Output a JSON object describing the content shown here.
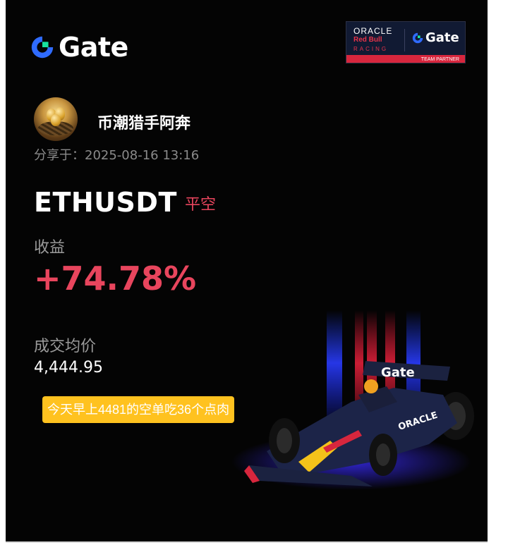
{
  "brand": {
    "name": "Gate",
    "color": "#2f6bff"
  },
  "partner": {
    "oracle": "ORACLE",
    "redbull": "Red Bull",
    "racing": "RACING",
    "gate": "Gate",
    "label": "TEAM PARTNER"
  },
  "user": {
    "name": "币潮猎手阿奔",
    "shared_at": "分享于：2025-08-16 13:16",
    "avatar_icon": "golden-eggs-nest"
  },
  "trade": {
    "pair": "ETHUSDT",
    "side": "平空",
    "pnl_label": "收益",
    "pnl_value": "+74.78%",
    "avg_price_label": "成交均价",
    "avg_price_value": "4,444.95",
    "pnl_color": "#e8455d"
  },
  "note": {
    "text": "今天早上4481的空单吃36个点肉",
    "bg_color": "#ffc21f"
  },
  "artwork": {
    "icon": "f1-race-car",
    "car_wing_text": "Gate",
    "car_side_text": "ORACLE"
  }
}
